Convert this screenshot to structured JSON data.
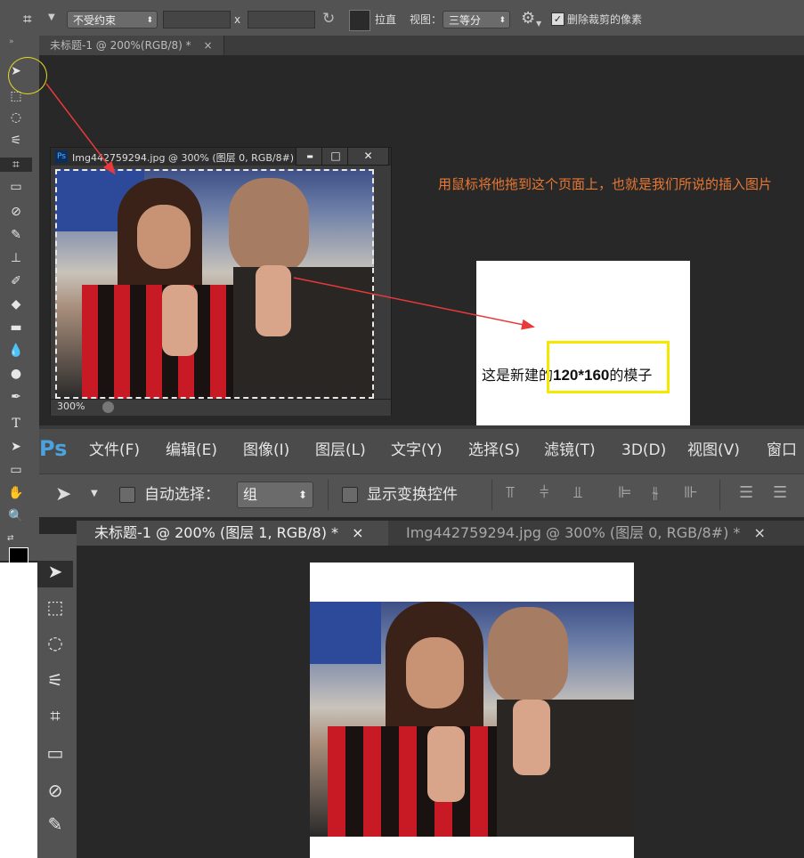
{
  "top_options": {
    "constraint_value": "不受约束",
    "times_symbol": "x",
    "straighten_label": "拉直",
    "view_label": "视图：",
    "view_value": "三等分",
    "delete_cropped_label": "删除裁剪的像素",
    "delete_cropped_checked": true
  },
  "tab_top": {
    "title": "未标题-1 @ 200%(RGB/8) *",
    "close": "×"
  },
  "image_window": {
    "title": "Img442759294.jpg @ 300% (图层 0, RGB/8#)",
    "zoom": "300%",
    "minimize": "▬",
    "maximize": "□",
    "close": "✕"
  },
  "annotation": {
    "instruction": "用鼠标将他拖到这个页面上，也就是我们所说的插入图片",
    "canvas_caption_prefix": "这是新建的",
    "canvas_caption_bold": "120*160",
    "canvas_caption_suffix": "的模子"
  },
  "ps2": {
    "logo": "Ps",
    "menu": [
      "文件(F)",
      "编辑(E)",
      "图像(I)",
      "图层(L)",
      "文字(Y)",
      "选择(S)",
      "滤镜(T)",
      "3D(D)",
      "视图(V)",
      "窗口"
    ],
    "auto_select_label": "自动选择：",
    "auto_select_value": "组",
    "show_transform_label": "显示变换控件",
    "tabs": [
      {
        "label": "未标题-1 @ 200% (图层 1, RGB/8) *",
        "close": "×",
        "active": true
      },
      {
        "label": "Img442759294.jpg @ 300% (图层 0, RGB/8#) *",
        "close": "×",
        "active": false
      }
    ]
  },
  "colors": {
    "annotation_orange": "#e87833",
    "highlight_yellow": "#f5e800",
    "arrow_red": "#e83a3a"
  }
}
